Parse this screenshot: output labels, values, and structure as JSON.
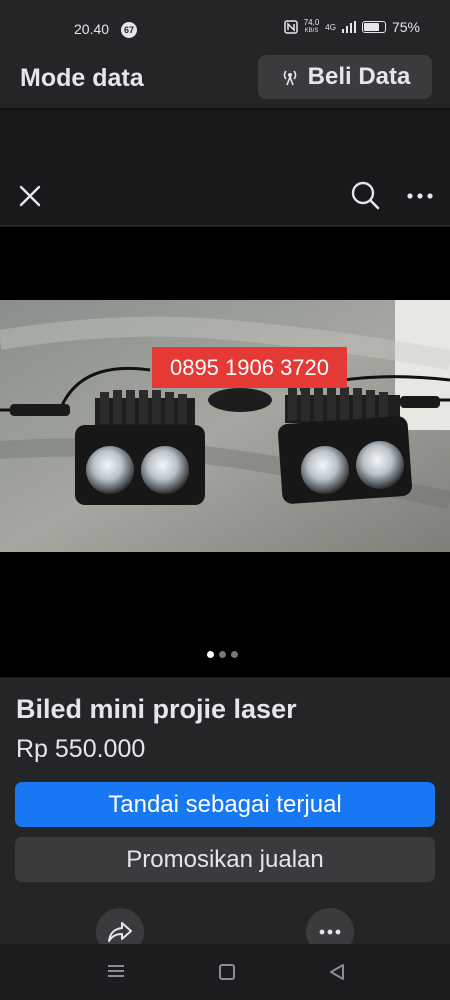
{
  "status": {
    "time": "20.40",
    "notif_badge": "67",
    "net_speed_value": "74,0",
    "net_speed_unit": "KB/S",
    "network": "4G",
    "battery": "75%"
  },
  "data_bar": {
    "title": "Mode data",
    "buy_label": "Beli Data"
  },
  "viewer": {
    "close_icon": "close-icon",
    "search_icon": "search-icon",
    "more_icon": "more-icon",
    "phone_overlay": "0895 1906 3720",
    "carousel_total": 3,
    "carousel_index": 1
  },
  "listing": {
    "title": "Biled mini projie laser",
    "price": "Rp 550.000",
    "primary_label": "Tandai sebagai terjual",
    "secondary_label": "Promosikan jualan"
  },
  "colors": {
    "primary": "#1877f2",
    "overlay": "#e53935",
    "surface": "#242526"
  }
}
